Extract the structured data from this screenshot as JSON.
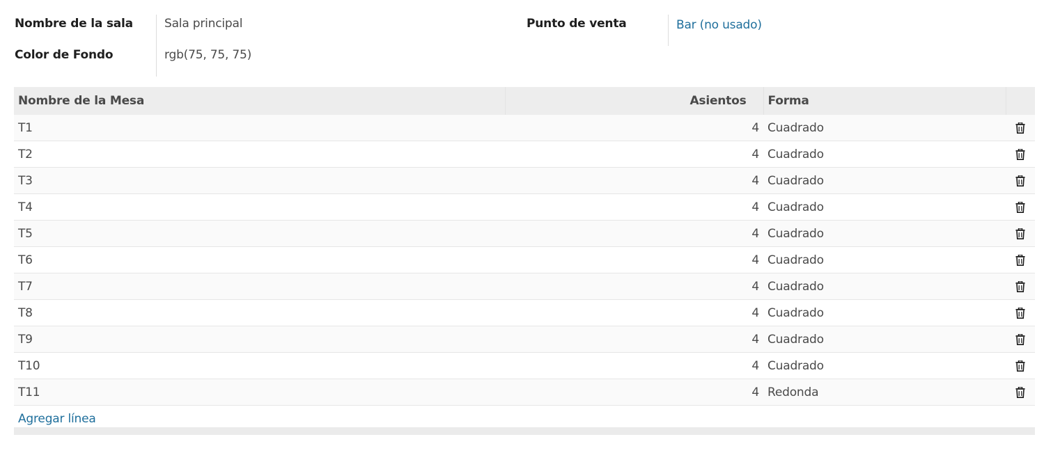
{
  "form": {
    "room_name_label": "Nombre de la sala",
    "room_name_value": "Sala principal",
    "bg_color_label": "Color de Fondo",
    "bg_color_value": "rgb(75, 75, 75)",
    "pos_label": "Punto de venta",
    "pos_value": "Bar (no usado)"
  },
  "table": {
    "headers": {
      "name": "Nombre de la Mesa",
      "seats": "Asientos",
      "shape": "Forma"
    },
    "rows": [
      {
        "name": "T1",
        "seats": "4",
        "shape": "Cuadrado"
      },
      {
        "name": "T2",
        "seats": "4",
        "shape": "Cuadrado"
      },
      {
        "name": "T3",
        "seats": "4",
        "shape": "Cuadrado"
      },
      {
        "name": "T4",
        "seats": "4",
        "shape": "Cuadrado"
      },
      {
        "name": "T5",
        "seats": "4",
        "shape": "Cuadrado"
      },
      {
        "name": "T6",
        "seats": "4",
        "shape": "Cuadrado"
      },
      {
        "name": "T7",
        "seats": "4",
        "shape": "Cuadrado"
      },
      {
        "name": "T8",
        "seats": "4",
        "shape": "Cuadrado"
      },
      {
        "name": "T9",
        "seats": "4",
        "shape": "Cuadrado"
      },
      {
        "name": "T10",
        "seats": "4",
        "shape": "Cuadrado"
      },
      {
        "name": "T11",
        "seats": "4",
        "shape": "Redonda"
      }
    ],
    "row_action_icon": "trash-icon",
    "add_line_label": "Agregar línea"
  },
  "colors": {
    "link": "#1f6f9c",
    "header_bg": "#ededed"
  }
}
